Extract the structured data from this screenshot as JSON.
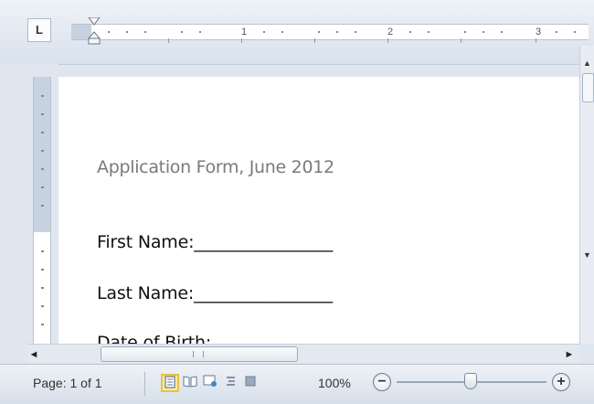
{
  "ruler": {
    "corner_label": "L",
    "numbers": [
      "1",
      "2",
      "3"
    ]
  },
  "document": {
    "title": "Application Form, June 2012",
    "fields": [
      {
        "label": "First Name:",
        "line": "________________"
      },
      {
        "label": "Last Name:",
        "line": "________________"
      },
      {
        "label": "Date of Birth:",
        "line": ""
      }
    ]
  },
  "status_bar": {
    "page_info": "Page: 1 of 1",
    "zoom_percent": "100%",
    "zoom_level": 100,
    "views": [
      "print-layout-icon",
      "full-screen-reading-icon",
      "web-layout-icon",
      "outline-icon",
      "draft-icon"
    ]
  },
  "icons": {
    "zoom_minus": "−",
    "zoom_plus": "+",
    "scroll_left": "◄",
    "scroll_right": "►",
    "scroll_up": "▲",
    "scroll_down": "▼"
  }
}
